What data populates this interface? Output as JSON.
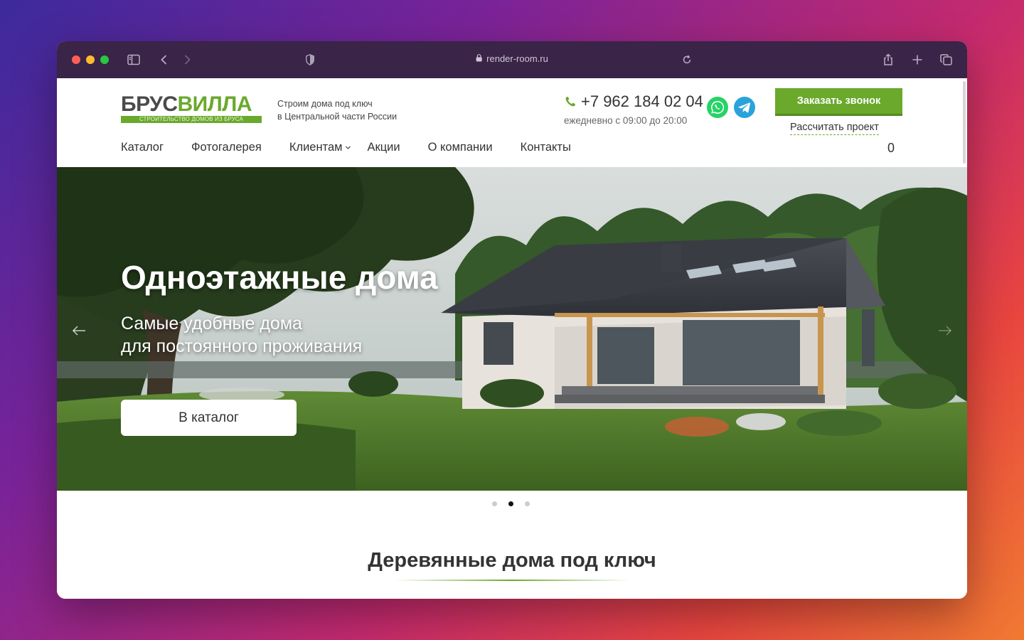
{
  "browser": {
    "url": "render-room.ru",
    "icons": [
      "sidebar-icon",
      "back-icon",
      "forward-icon",
      "shield-icon",
      "lock-icon",
      "reload-icon",
      "share-icon",
      "new-tab-icon",
      "tabs-icon"
    ]
  },
  "header": {
    "logo_part1": "БРУС",
    "logo_part2": "ВИЛЛА",
    "logo_tagline": "СТРОИТЕЛЬСТВО ДОМОВ ИЗ БРУСА",
    "slogan_line1": "Строим дома под ключ",
    "slogan_line2": "в Центральной части России",
    "phone": "+7 962 184 02 04",
    "hours": "ежедневно с 09:00 до 20:00",
    "callback_label": "Заказать звонок",
    "calc_label": "Рассчитать проект",
    "cart_count": "0"
  },
  "nav": {
    "items": [
      {
        "label": "Каталог"
      },
      {
        "label": "Фотогалерея"
      },
      {
        "label": "Клиентам"
      },
      {
        "label": "Акции"
      },
      {
        "label": "О компании"
      },
      {
        "label": "Контакты"
      }
    ]
  },
  "hero": {
    "title": "Одноэтажные дома",
    "subtitle_line1": "Самые удобные дома",
    "subtitle_line2": "для постоянного проживания",
    "button_label": "В каталог",
    "slides_total": 3,
    "active_slide": 2
  },
  "section": {
    "title": "Деревянные дома под ключ"
  },
  "colors": {
    "brand_green": "#6aa92c",
    "toolbar": "#3a2447",
    "whatsapp": "#25d366",
    "telegram": "#2aa3db"
  }
}
